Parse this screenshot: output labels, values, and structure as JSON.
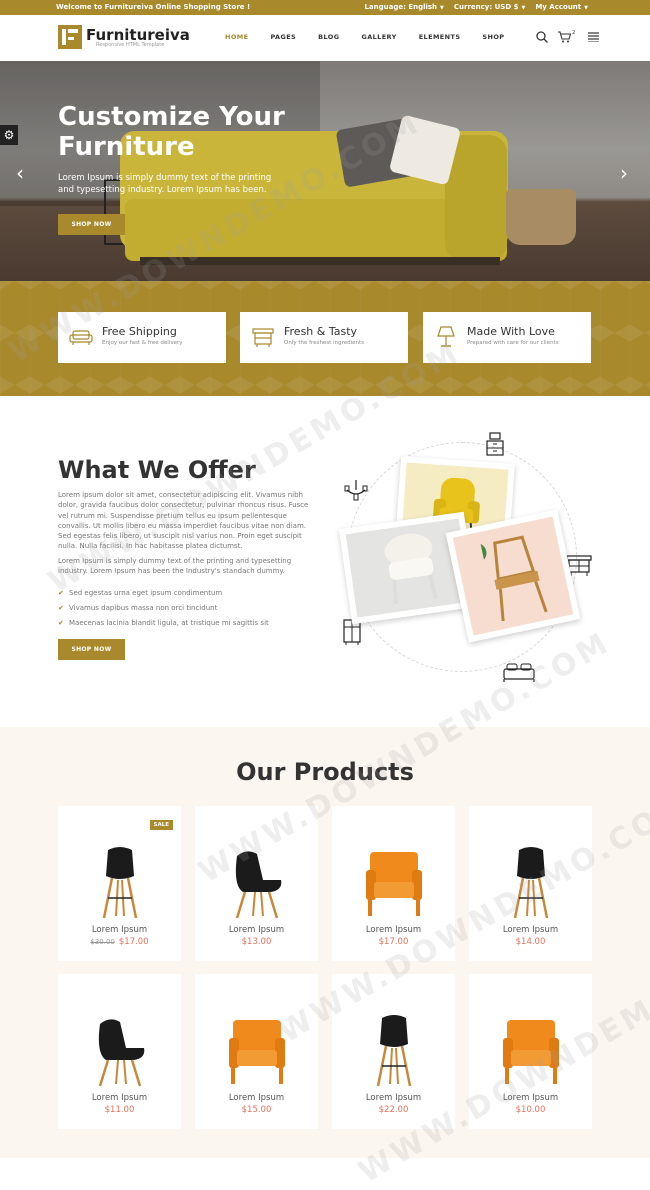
{
  "topbar": {
    "welcome": "Welcome to Furnitureiva Online Shopping Store !",
    "language": "Language: English",
    "currency": "Currency: USD $",
    "account": "My Account"
  },
  "header": {
    "brand": "Furnitureiva",
    "tagline": "Responsive HTML Template",
    "nav": [
      "HOME",
      "PAGES",
      "BLOG",
      "GALLERY",
      "ELEMENTS",
      "SHOP"
    ],
    "active_nav": "HOME",
    "cart_count": "2"
  },
  "hero": {
    "title": "Customize Your Furniture",
    "text": "Lorem Ipsum is simply dummy text of the printing and typesetting industry. Lorem Ipsum has been.",
    "button": "SHOP NOW"
  },
  "features": [
    {
      "title": "Free Shipping",
      "subtitle": "Enjoy our fast & free delivery",
      "icon": "sofa-icon"
    },
    {
      "title": "Fresh & Tasty",
      "subtitle": "Only the freshest ingredients",
      "icon": "drawer-icon"
    },
    {
      "title": "Made With Love",
      "subtitle": "Prepared with care for our clients",
      "icon": "lamp-icon"
    }
  ],
  "offer": {
    "title": "What We Offer",
    "paragraph1": "Lorem ipsum dolor sit amet, consectetur adipiscing elit. Vivamus nibh dolor, gravida faucibus dolor consectetur, pulvinar rhoncus risus. Fusce vel rutrum mi. Suspendisse pretium tellus eu ipsum pellentesque convallis. Ut mollis libero eu massa imperdiet faucibus vitae non diam. Sed egestas felis libero, ut suscipit nisl varius non. Proin eget suscipit nulla. Nulla facilisi. In hac habitasse platea dictumst.",
    "paragraph2": "Lorem Ipsum is simply dummy text of the printing and typesetting industry. Lorem Ipsum has been the Industry's standach dummy.",
    "bullets": [
      "Sed egestas urna eget ipsum condimentum",
      "Vivamus dapibus massa non orci tincidunt",
      "Maecenas lacinia blandit ligula, at tristique mi sagittis sit"
    ],
    "button": "SHOP NOW"
  },
  "products": {
    "title": "Our Products",
    "items": [
      {
        "name": "Lorem Ipsum",
        "old_price": "$30.00",
        "price": "$17.00",
        "badge": "SALE",
        "chair": "black-stool"
      },
      {
        "name": "Lorem Ipsum",
        "old_price": "",
        "price": "$13.00",
        "badge": "",
        "chair": "black-lounge"
      },
      {
        "name": "Lorem Ipsum",
        "old_price": "",
        "price": "$17.00",
        "badge": "",
        "chair": "orange-armchair"
      },
      {
        "name": "Lorem Ipsum",
        "old_price": "",
        "price": "$14.00",
        "badge": "",
        "chair": "black-stool"
      },
      {
        "name": "Lorem Ipsum",
        "old_price": "",
        "price": "$11.00",
        "badge": "",
        "chair": "black-lounge"
      },
      {
        "name": "Lorem Ipsum",
        "old_price": "",
        "price": "$15.00",
        "badge": "",
        "chair": "orange-armchair"
      },
      {
        "name": "Lorem Ipsum",
        "old_price": "",
        "price": "$22.00",
        "badge": "",
        "chair": "black-stool"
      },
      {
        "name": "Lorem Ipsum",
        "old_price": "",
        "price": "$10.00",
        "badge": "",
        "chair": "orange-armchair"
      }
    ]
  },
  "watermark": "WWW.DOWNDEMO.COM",
  "colors": {
    "accent": "#a8892c",
    "price": "#e8705a",
    "products_bg": "#fcf6f0"
  }
}
